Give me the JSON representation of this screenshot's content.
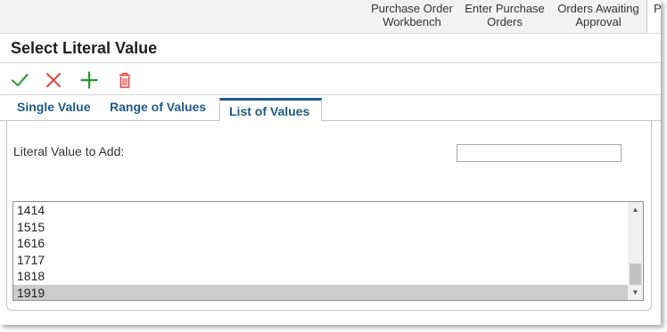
{
  "topnav": {
    "items": [
      {
        "line1": "Purchase Order",
        "line2": "Workbench"
      },
      {
        "line1": "Enter Purchase",
        "line2": "Orders"
      },
      {
        "line1": "Orders Awaiting",
        "line2": "Approval"
      }
    ],
    "active_partial": "Pe"
  },
  "page": {
    "title": "Select Literal Value"
  },
  "toolbar": {
    "icons": [
      "check-icon",
      "cancel-x-icon",
      "add-plus-icon",
      "delete-trash-icon"
    ],
    "colors": {
      "check": "#3a9a3a",
      "cancel": "#e0443a",
      "add": "#2e9a3a",
      "delete": "#e0443a"
    }
  },
  "tabs": [
    {
      "label": "Single Value",
      "active": false
    },
    {
      "label": "Range of Values",
      "active": false
    },
    {
      "label": "List of Values",
      "active": true
    }
  ],
  "form": {
    "literal_label": "Literal Value to Add:",
    "literal_value": ""
  },
  "list": {
    "items": [
      "1414",
      "1515",
      "1616",
      "1717",
      "1818",
      "1919"
    ],
    "selected": "1919"
  },
  "colors": {
    "accent": "#1e5a8c",
    "selection": "#cccccc"
  }
}
